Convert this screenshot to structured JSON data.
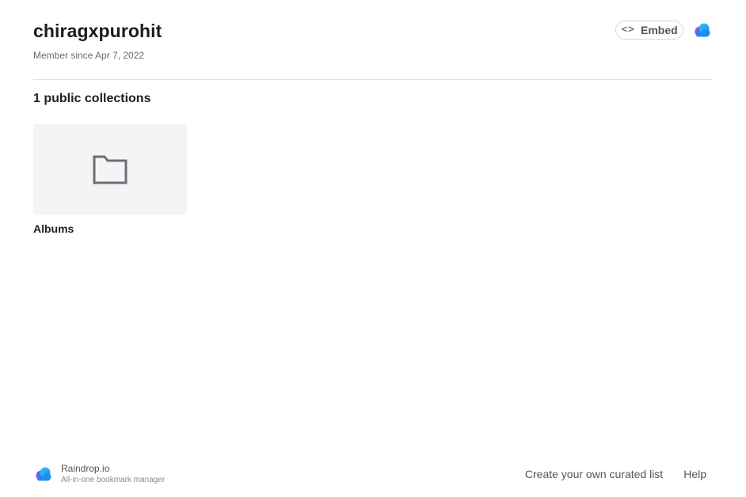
{
  "profile": {
    "username": "chiragxpurohit",
    "member_since": "Member since Apr 7, 2022"
  },
  "header": {
    "embed_label": "Embed",
    "embed_icon": "code-icon",
    "logo_icon": "raindrop-cloud-icon"
  },
  "collections": {
    "heading": "1 public collections",
    "items": [
      {
        "title": "Albums",
        "icon": "folder-icon"
      }
    ]
  },
  "footer": {
    "brand": "Raindrop.io",
    "tagline": "All-in-one bookmark manager",
    "links": [
      "Create your own curated list",
      "Help"
    ]
  },
  "colors": {
    "brand_blue": "#1d8ef0",
    "brand_purple": "#6f5cf1",
    "brand_cyan": "#34c3f5",
    "divider": "#e3e3e3",
    "thumb_bg": "#f3f4f6",
    "folder_stroke": "#6b6f73"
  }
}
